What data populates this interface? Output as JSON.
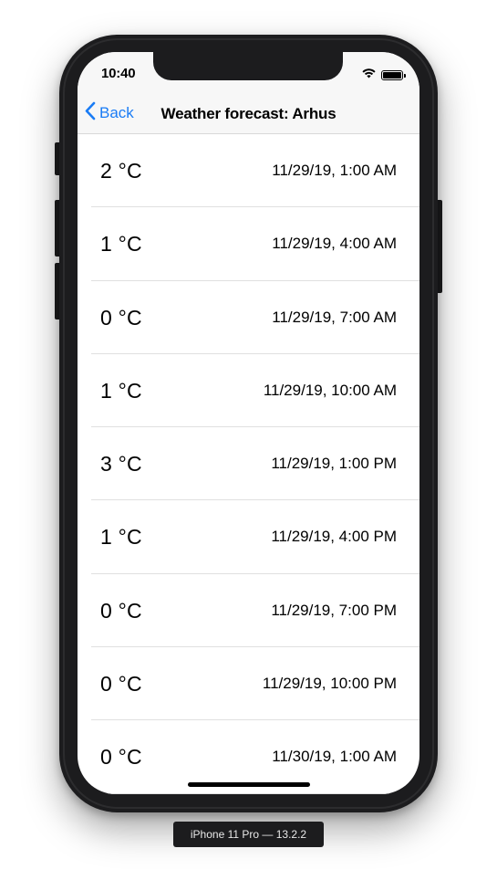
{
  "device": {
    "label": "iPhone 11 Pro — 13.2.2"
  },
  "status_bar": {
    "time": "10:40",
    "icons": [
      "wifi-icon",
      "battery-icon"
    ]
  },
  "nav": {
    "back_label": "Back",
    "title": "Weather forecast: Arhus"
  },
  "colors": {
    "accent": "#1a7cf5",
    "nav_background": "#f7f7f7",
    "separator": "#e0e0e0"
  },
  "forecast": [
    {
      "temp": "2 °C",
      "datetime": "11/29/19, 1:00 AM"
    },
    {
      "temp": "1 °C",
      "datetime": "11/29/19, 4:00 AM"
    },
    {
      "temp": "0 °C",
      "datetime": "11/29/19, 7:00 AM"
    },
    {
      "temp": "1 °C",
      "datetime": "11/29/19, 10:00 AM"
    },
    {
      "temp": "3 °C",
      "datetime": "11/29/19, 1:00 PM"
    },
    {
      "temp": "1 °C",
      "datetime": "11/29/19, 4:00 PM"
    },
    {
      "temp": "0 °C",
      "datetime": "11/29/19, 7:00 PM"
    },
    {
      "temp": "0 °C",
      "datetime": "11/29/19, 10:00 PM"
    },
    {
      "temp": "0 °C",
      "datetime": "11/30/19, 1:00 AM"
    }
  ]
}
